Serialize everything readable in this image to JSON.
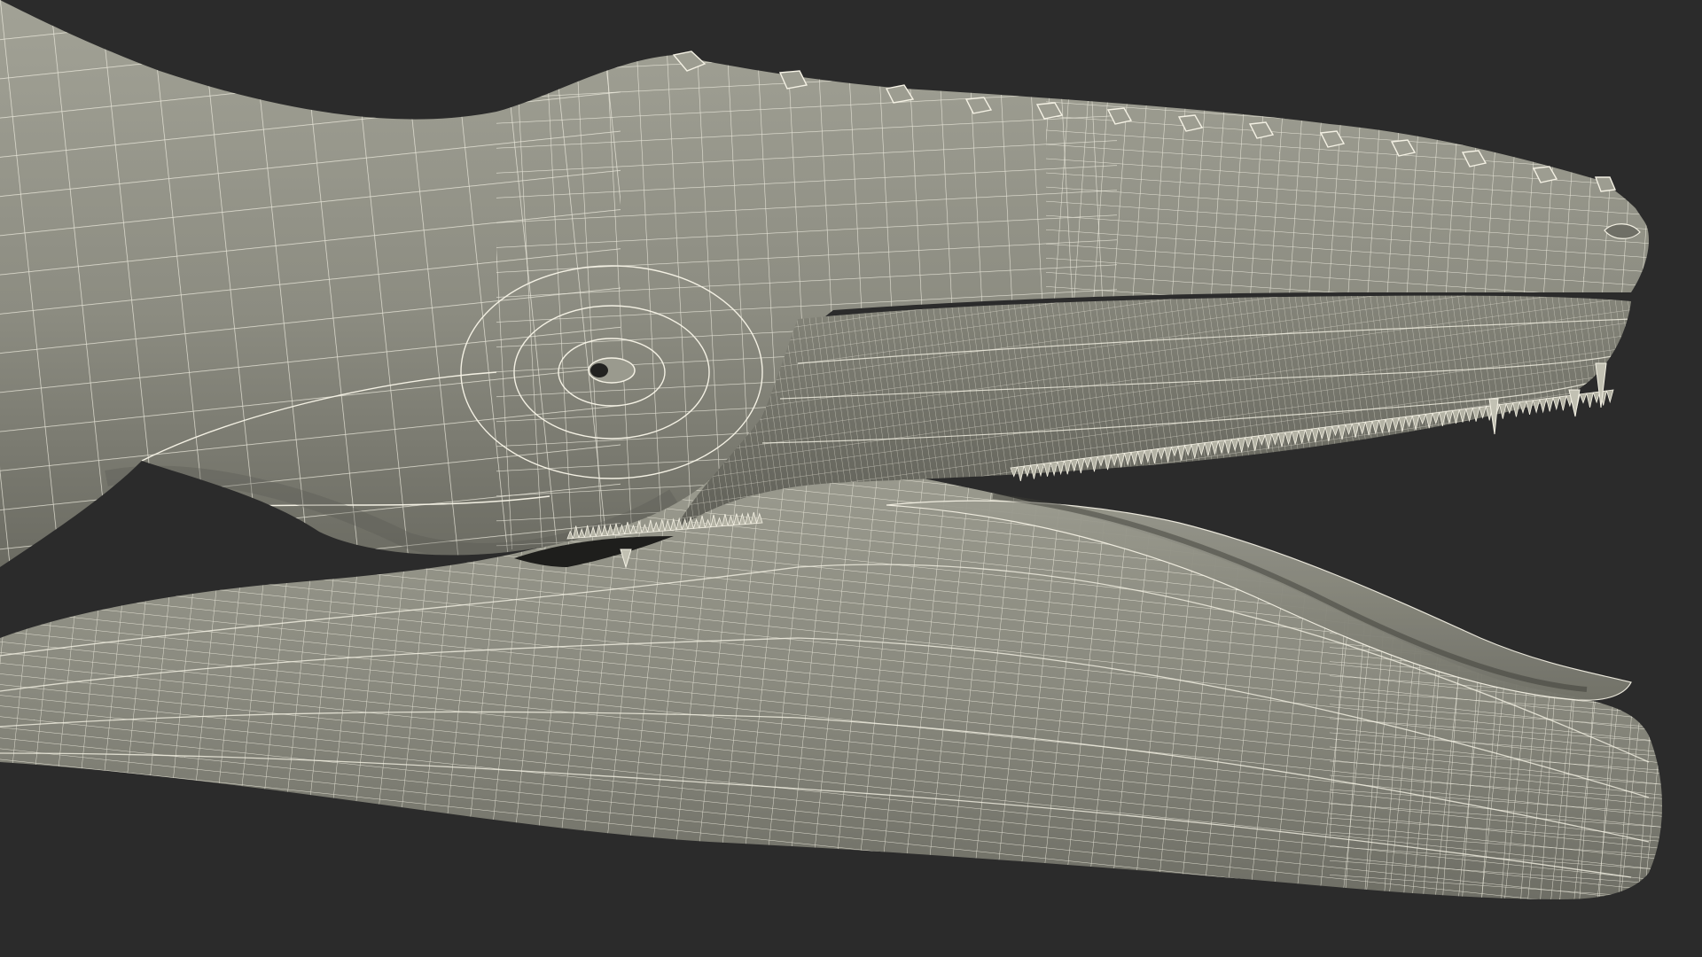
{
  "scene": {
    "subject": "crocodile-head-wireframe",
    "colors": {
      "background": "#2b2b2b",
      "skin": "#8b8b80",
      "skin_light": "#a4a498",
      "skin_dark": "#5d5d55",
      "mouth_inner": "#767669",
      "gum": "#9a9a8e",
      "wire": "#f4f1e4",
      "shadow": "#1e1e1c"
    }
  }
}
